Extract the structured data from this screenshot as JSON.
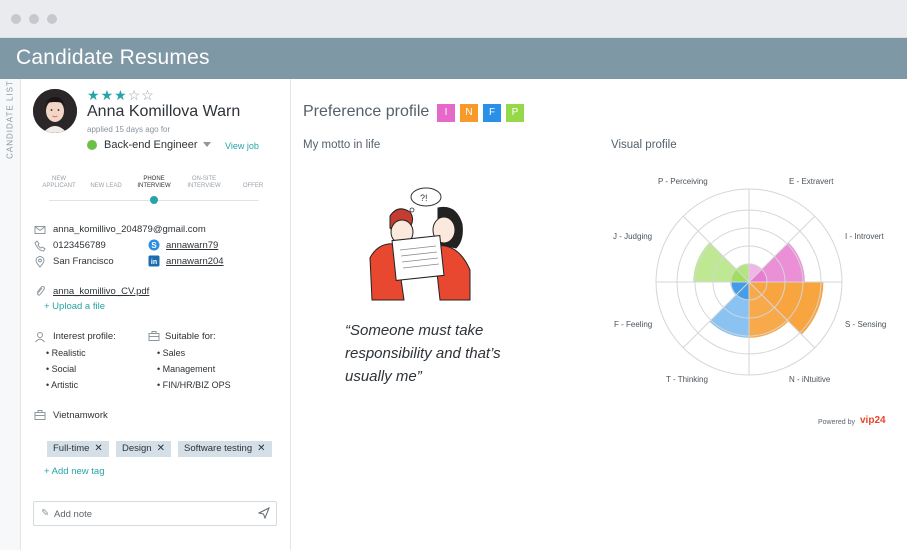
{
  "window": {
    "title": "Candidate Resumes"
  },
  "side_tab": {
    "label": "CANDIDATE LIST"
  },
  "candidate": {
    "rating": 3,
    "rating_max": 5,
    "name": "Anna Komillova Warn",
    "applied": "applied 15 days ago for",
    "job": "Back-end Engineer",
    "view_job": "View job",
    "stages": [
      {
        "label": "NEW APPLICANT",
        "l1": "NEW",
        "l2": "APPLICANT"
      },
      {
        "label": "NEW LEAD",
        "l1": "",
        "l2": "NEW LEAD"
      },
      {
        "label": "PHONE INTERVIEW",
        "l1": "PHONE",
        "l2": "INTERVIEW"
      },
      {
        "label": "ON-SITE INTERVIEW",
        "l1": "ON-SITE",
        "l2": "INTERVIEW"
      },
      {
        "label": "OFFER",
        "l1": "",
        "l2": "OFFER"
      }
    ],
    "current_stage": "PHONE INTERVIEW",
    "email": "anna_komillivo_204879@gmail.com",
    "phone": "0123456789",
    "skype": "annawarn79",
    "location": "San Francisco",
    "linkedin": "annawarn204",
    "cv_file": "anna_komillivo_CV.pdf",
    "upload": "+ Upload a file",
    "interest_label": "Interest profile:",
    "interest": [
      "Realistic",
      "Social",
      "Artistic"
    ],
    "suitable_label": "Suitable for:",
    "suitable": [
      "Sales",
      "Management",
      "FIN/HR/BIZ OPS"
    ],
    "source": "Vietnamwork",
    "tags": [
      "Full-time",
      "Design",
      "Software testing"
    ],
    "add_tag": "+ Add new tag",
    "note_placeholder": "Add note"
  },
  "preference": {
    "title": "Preference profile",
    "type": [
      {
        "letter": "I",
        "color": "#e469c9"
      },
      {
        "letter": "N",
        "color": "#f79a2a"
      },
      {
        "letter": "F",
        "color": "#2a8fe6"
      },
      {
        "letter": "P",
        "color": "#95d94b"
      }
    ],
    "motto_heading": "My motto in life",
    "motto": "“Someone must take responsibility and that’s usually me”",
    "visual_heading": "Visual profile",
    "radar_labels": {
      "p": "P - Perceiving",
      "e": "E - Extravert",
      "j": "J - Judging",
      "i": "I - Introvert",
      "f": "F - Feeling",
      "s": "S - Sensing",
      "t": "T - Thinking",
      "n": "N - iNtuitive"
    },
    "radar_levels": {
      "p": 0,
      "e": 0,
      "j": 0.6,
      "i": 0.6,
      "f": 0.2,
      "s": 0.8,
      "t": 0.6,
      "n": 0.6
    },
    "powered_by": "Powered by",
    "brand": "vip24"
  }
}
